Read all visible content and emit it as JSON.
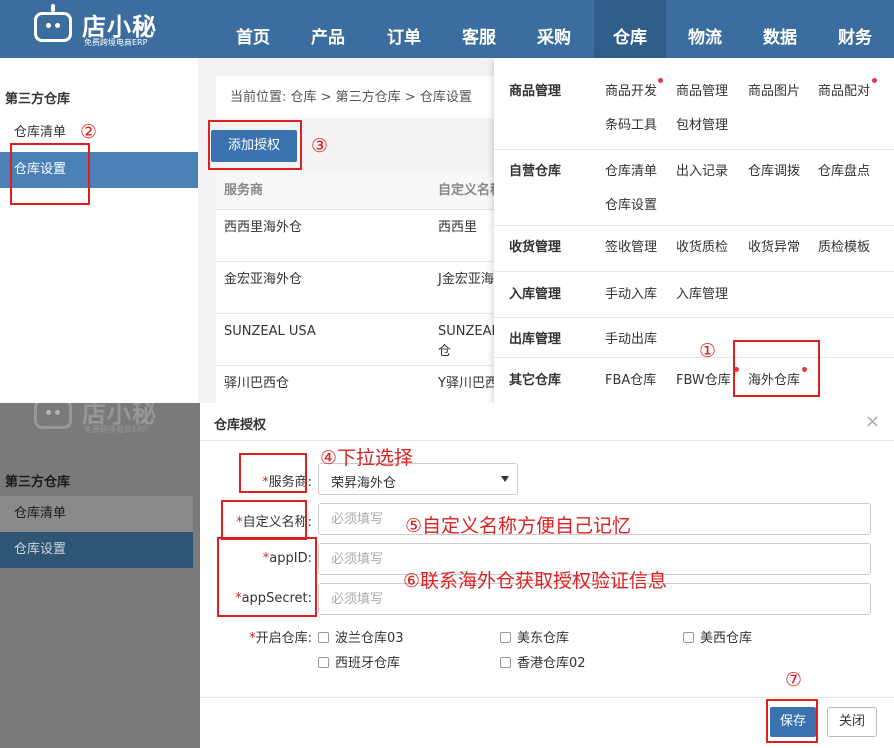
{
  "colors": {
    "nav": "#3b6e9e",
    "accent": "#3b73b0",
    "annotation": "#e02020"
  },
  "logo": {
    "name": "店小秘",
    "subtitle": "免费跨境电商ERP"
  },
  "nav_items": [
    "首页",
    "产品",
    "订单",
    "客服",
    "采购",
    "仓库",
    "物流",
    "数据",
    "财务"
  ],
  "active_nav": "仓库",
  "sidebar": {
    "title": "第三方仓库",
    "items": [
      "仓库清单",
      "仓库设置"
    ],
    "active": "仓库设置"
  },
  "breadcrumb": "当前位置:  仓库 > 第三方仓库 > 仓库设置",
  "add_auth_button": "添加授权",
  "table": {
    "headers": [
      "服务商",
      "自定义名称"
    ],
    "rows": [
      [
        "西西里海外仓",
        "西西里"
      ],
      [
        "金宏亚海外仓",
        "J金宏亚海"
      ],
      [
        "SUNZEAL USA",
        "SUNZEAL\n仓"
      ],
      [
        "驿川巴西仓",
        "Y驿川巴西"
      ]
    ]
  },
  "mega_menu": [
    {
      "category": "商品管理",
      "links": [
        "商品开发",
        "商品管理",
        "商品图片",
        "商品配对",
        "条码工具",
        "包材管理"
      ]
    },
    {
      "category": "自营仓库",
      "links": [
        "仓库清单",
        "出入记录",
        "仓库调拨",
        "仓库盘点",
        "仓库设置"
      ]
    },
    {
      "category": "收货管理",
      "links": [
        "签收管理",
        "收货质检",
        "收货异常",
        "质检模板"
      ]
    },
    {
      "category": "入库管理",
      "links": [
        "手动入库",
        "入库管理"
      ]
    },
    {
      "category": "出库管理",
      "links": [
        "手动出库"
      ]
    },
    {
      "category": "其它仓库",
      "links": [
        "FBA仓库",
        "FBW仓库",
        "海外仓库"
      ]
    }
  ],
  "modal": {
    "title": "仓库授权",
    "close": "×",
    "provider_label": "服务商:",
    "provider_value": "荣昇海外仓",
    "custom_name_label": "自定义名称:",
    "appid_label": "appID:",
    "appsecret_label": "appSecret:",
    "placeholder": "必须填写",
    "warehouses_label": "开启仓库:",
    "warehouses": [
      "波兰仓库03",
      "美东仓库",
      "美西仓库",
      "西班牙仓库",
      "香港仓库02"
    ],
    "save": "保存",
    "close_button": "关闭"
  },
  "annotations": {
    "n1": "①",
    "n2": "②",
    "n3": "③",
    "n7": "⑦",
    "step4": "④下拉选择",
    "step5": "⑤自定义名称方便自己记忆",
    "step6": "⑥联系海外仓获取授权验证信息"
  }
}
